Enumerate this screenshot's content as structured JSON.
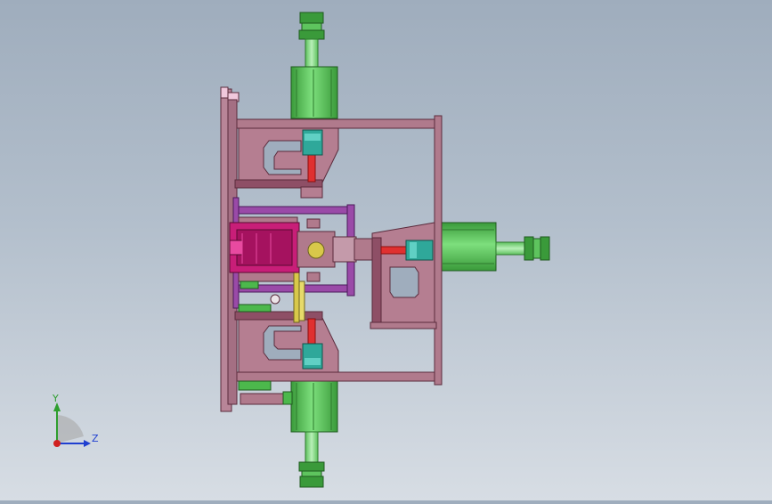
{
  "triad": {
    "x_label": "",
    "y_label": "Y",
    "z_label": "Z",
    "y_axis_color": "#2e9e2e",
    "z_axis_color": "#1f3fd0",
    "x_axis_color": "#d02020"
  },
  "colors": {
    "background_top": "#9fadbd",
    "background_bottom": "#d7dde4",
    "frame_mauve": "#b07a8c",
    "frame_dark": "#6d3a4d",
    "cylinder_green": "#4cb84c",
    "rod_light_green": "#7fd67f",
    "fitting_teal": "#2fa89a",
    "piston_red": "#e03030",
    "block_magenta": "#c81e78",
    "purple_plate": "#9a4aa8",
    "yellow_part": "#d8c84a"
  }
}
